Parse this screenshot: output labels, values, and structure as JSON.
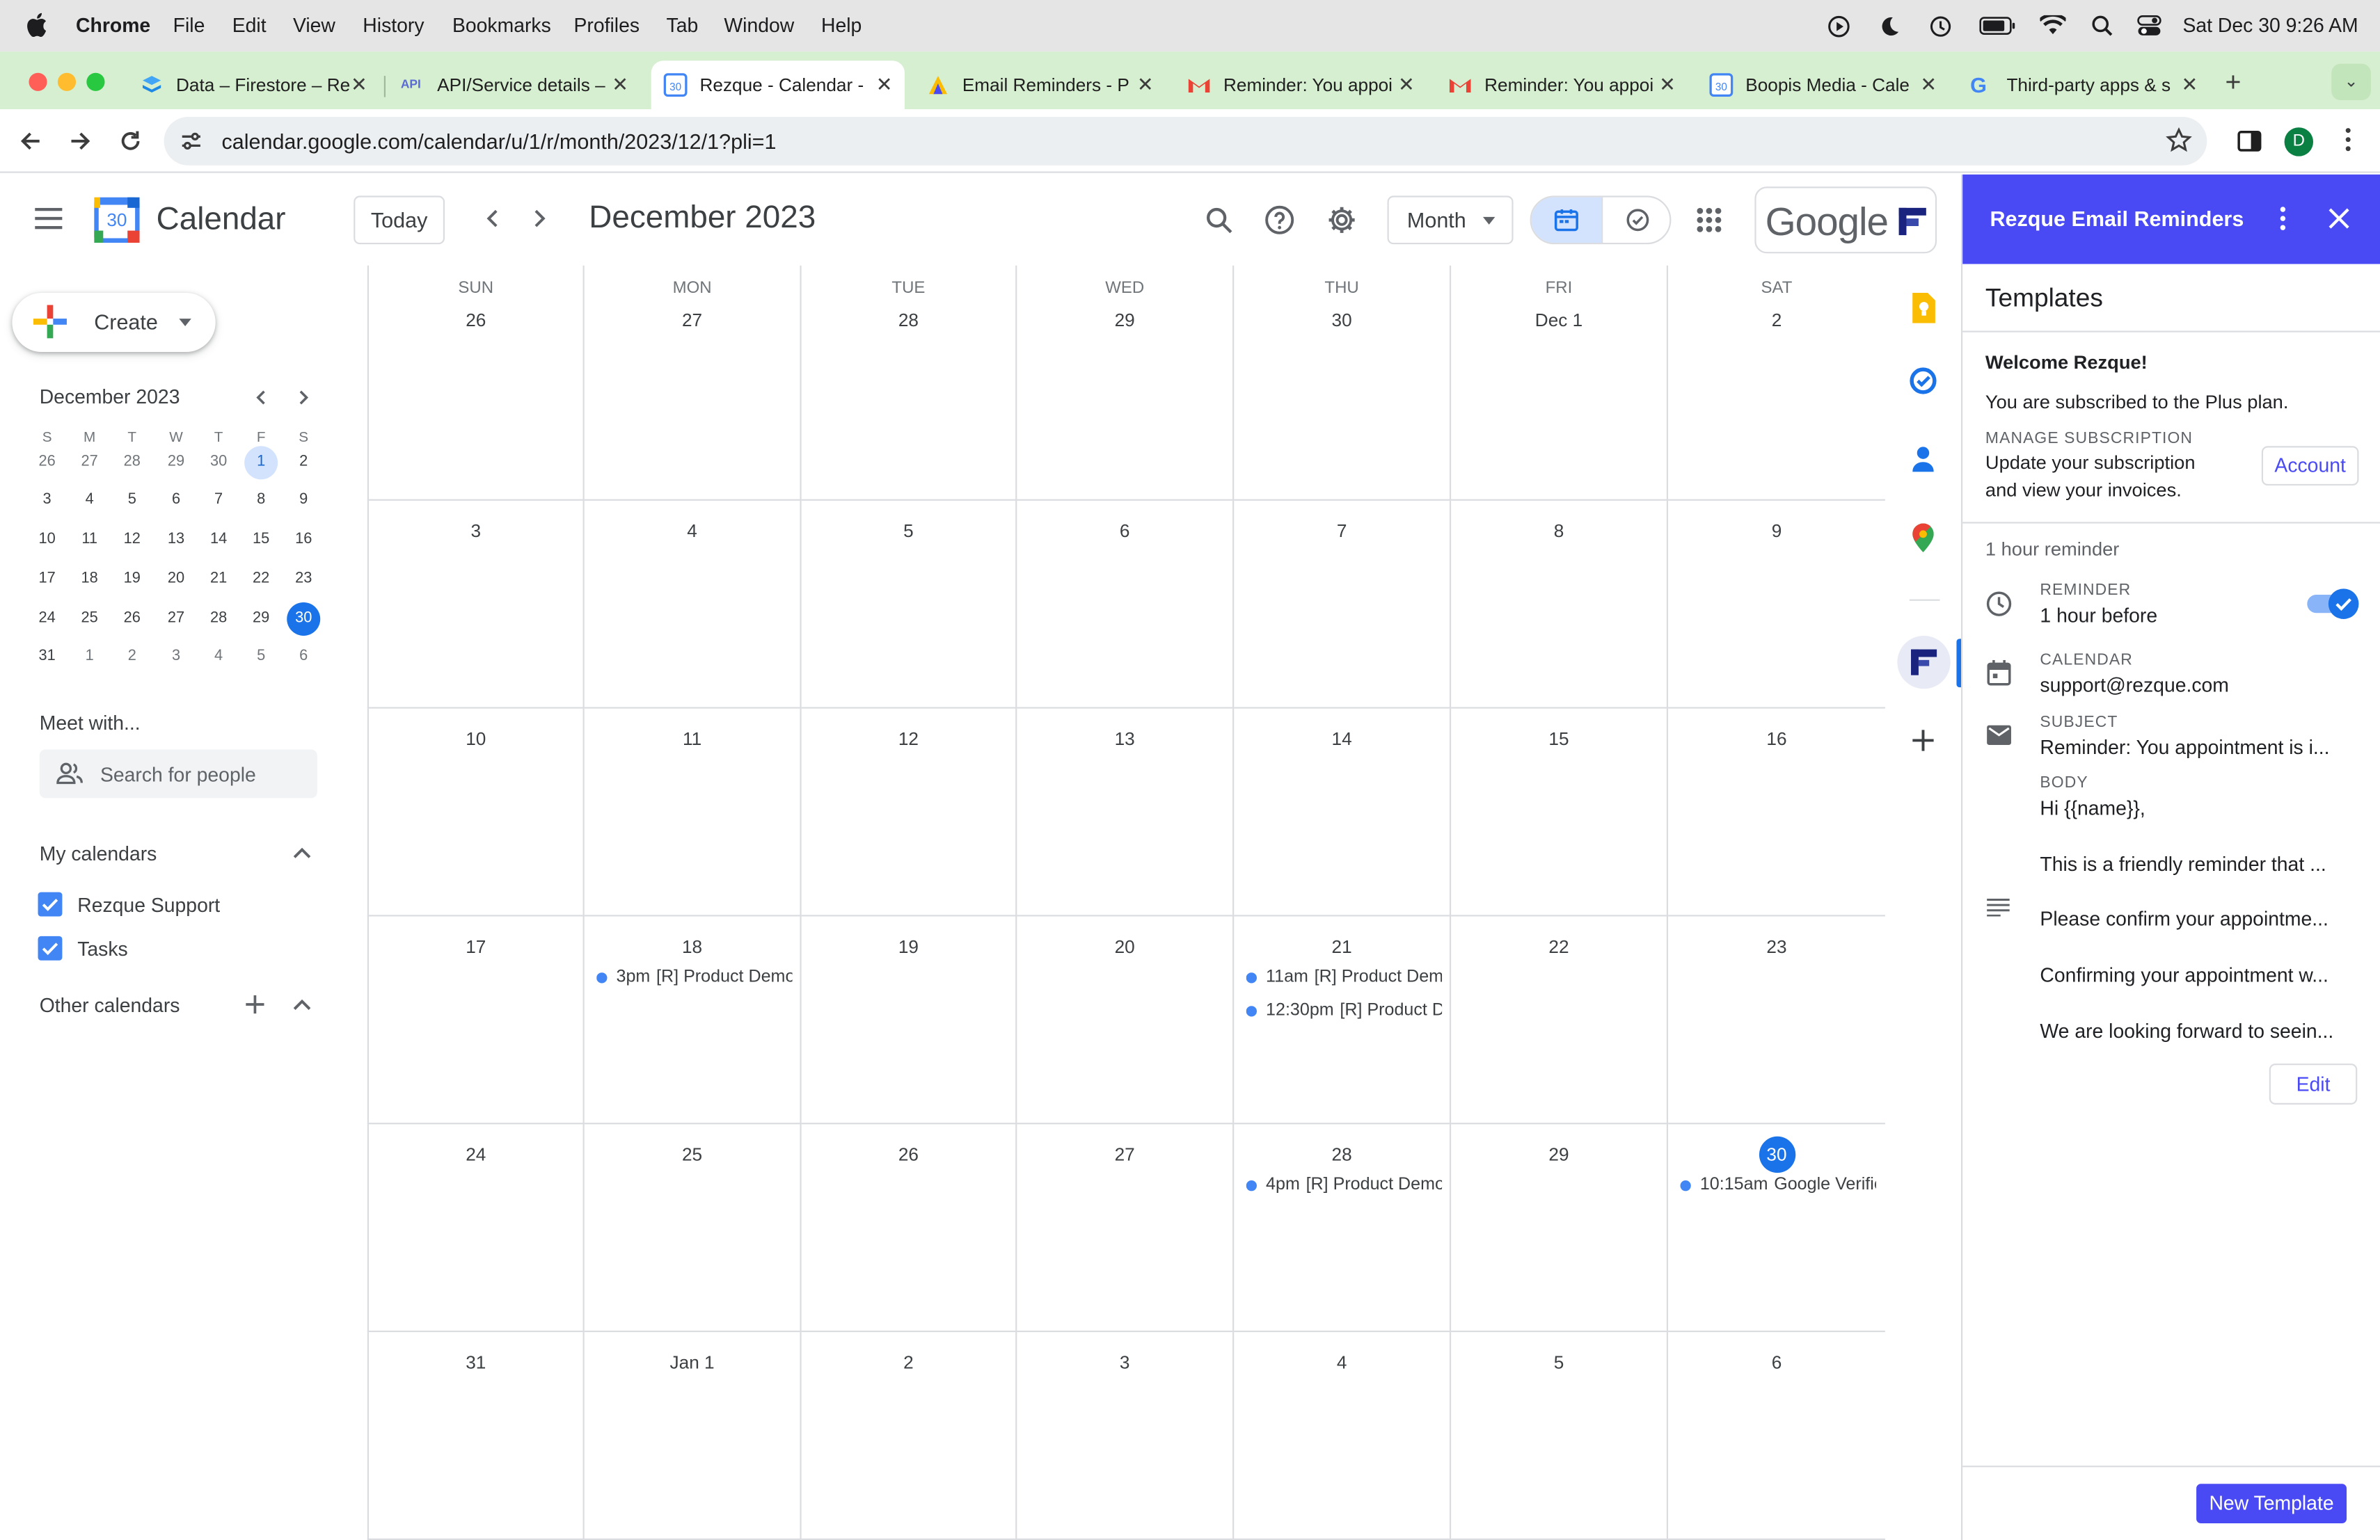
{
  "menubar": {
    "app": "Chrome",
    "items": [
      "File",
      "Edit",
      "View",
      "History",
      "Bookmarks",
      "Profiles",
      "Tab",
      "Window",
      "Help"
    ],
    "clock": "Sat Dec 30  9:26 AM"
  },
  "tabs": [
    {
      "title": "Data – Firestore – Re",
      "icon": "firestore-icon"
    },
    {
      "title": "API/Service details –",
      "icon": "api-icon"
    },
    {
      "title": "Rezque - Calendar -",
      "icon": "calendar-icon"
    },
    {
      "title": "Email Reminders - P",
      "icon": "rezque-icon"
    },
    {
      "title": "Reminder: You appoi",
      "icon": "gmail-icon"
    },
    {
      "title": "Reminder: You appoi",
      "icon": "gmail-icon"
    },
    {
      "title": "Boopis Media - Cale",
      "icon": "calendar-icon"
    },
    {
      "title": "Third-party apps & s",
      "icon": "google-icon"
    }
  ],
  "url": "calendar.google.com/calendar/u/1/r/month/2023/12/1?pli=1",
  "profile_initial": "D",
  "header": {
    "app_name": "Calendar",
    "logo_day": "30",
    "today_label": "Today",
    "title": "December 2023",
    "view_label": "Month",
    "brand": "Google"
  },
  "sidebar": {
    "create_label": "Create",
    "mini_title": "December 2023",
    "mini_dow": [
      "S",
      "M",
      "T",
      "W",
      "T",
      "F",
      "S"
    ],
    "mini_weeks": [
      [
        "26",
        "27",
        "28",
        "29",
        "30",
        "1",
        "2"
      ],
      [
        "3",
        "4",
        "5",
        "6",
        "7",
        "8",
        "9"
      ],
      [
        "10",
        "11",
        "12",
        "13",
        "14",
        "15",
        "16"
      ],
      [
        "17",
        "18",
        "19",
        "20",
        "21",
        "22",
        "23"
      ],
      [
        "24",
        "25",
        "26",
        "27",
        "28",
        "29",
        "30"
      ],
      [
        "31",
        "1",
        "2",
        "3",
        "4",
        "5",
        "6"
      ]
    ],
    "meet_title": "Meet with...",
    "search_placeholder": "Search for people",
    "my_calendars_title": "My calendars",
    "calendars": [
      {
        "name": "Rezque Support",
        "color": "#4285f4",
        "checked": true
      },
      {
        "name": "Tasks",
        "color": "#4285f4",
        "checked": true
      }
    ],
    "other_calendars_title": "Other calendars"
  },
  "grid": {
    "dow": [
      "SUN",
      "MON",
      "TUE",
      "WED",
      "THU",
      "FRI",
      "SAT"
    ],
    "weeks": [
      [
        "26",
        "27",
        "28",
        "29",
        "30",
        "Dec 1",
        "2"
      ],
      [
        "3",
        "4",
        "5",
        "6",
        "7",
        "8",
        "9"
      ],
      [
        "10",
        "11",
        "12",
        "13",
        "14",
        "15",
        "16"
      ],
      [
        "17",
        "18",
        "19",
        "20",
        "21",
        "22",
        "23"
      ],
      [
        "24",
        "25",
        "26",
        "27",
        "28",
        "29",
        "30"
      ],
      [
        "31",
        "Jan 1",
        "2",
        "3",
        "4",
        "5",
        "6"
      ]
    ],
    "today": "30",
    "events": {
      "w3d1": [
        {
          "time": "3pm",
          "title": "[R] Product Demo"
        }
      ],
      "w3d4": [
        {
          "time": "11am",
          "title": "[R] Product Demo"
        },
        {
          "time": "12:30pm",
          "title": "[R] Product Demo"
        }
      ],
      "w4d4": [
        {
          "time": "4pm",
          "title": "[R] Product Demo"
        }
      ],
      "w4d6": [
        {
          "time": "10:15am",
          "title": "Google Verification"
        }
      ]
    }
  },
  "panel": {
    "title": "Rezque Email Reminders",
    "section_title": "Templates",
    "welcome": "Welcome Rezque!",
    "plan_text": "You are subscribed to the Plus plan.",
    "manage_label": "MANAGE SUBSCRIPTION",
    "manage_text_1": "Update your subscription",
    "manage_text_2": "and view your invoices.",
    "account_button": "Account",
    "template_name": "1 hour reminder",
    "reminder_label": "REMINDER",
    "reminder_value": "1 hour before",
    "reminder_enabled": true,
    "calendar_label": "CALENDAR",
    "calendar_value": "support@rezque.com",
    "subject_label": "SUBJECT",
    "subject_value": "Reminder: You appointment is i...",
    "body_label": "BODY",
    "body_lines": [
      "Hi {{name}},",
      "This is a friendly reminder that ...",
      "Please confirm your appointme...",
      "Confirming your appointment w...",
      "We are looking forward to seein..."
    ],
    "edit_button": "Edit",
    "new_template_button": "New Template"
  },
  "colors": {
    "accent": "#4a4af5",
    "blue": "#1a73e8",
    "event_dot": "#4285f4",
    "tabstrip": "#d6efd0"
  }
}
